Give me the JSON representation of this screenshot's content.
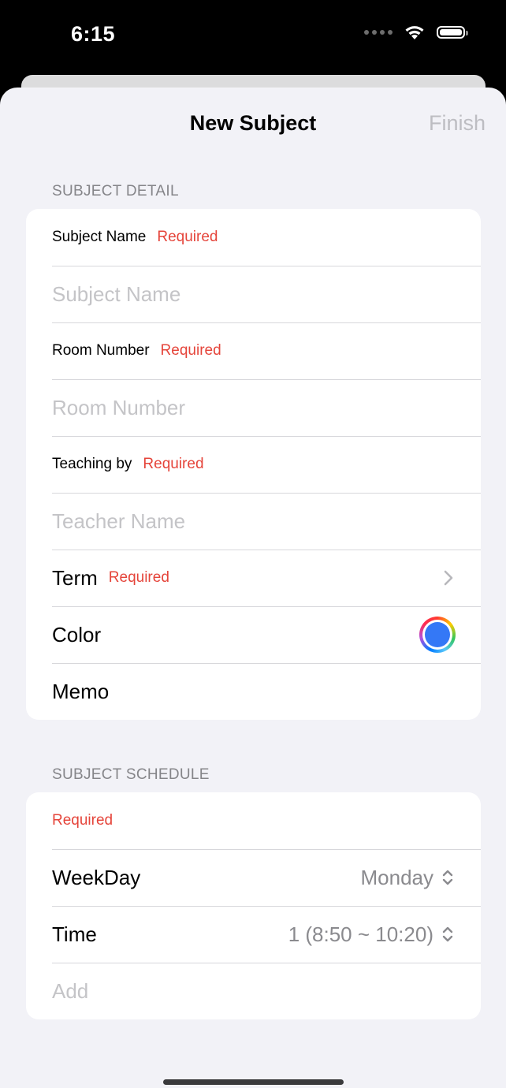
{
  "status_bar": {
    "time": "6:15"
  },
  "nav": {
    "title": "New Subject",
    "finish_label": "Finish"
  },
  "subject_detail": {
    "header": "SUBJECT DETAIL",
    "subject_name": {
      "label": "Subject Name",
      "required": "Required",
      "placeholder": "Subject Name"
    },
    "room_number": {
      "label": "Room Number",
      "required": "Required",
      "placeholder": "Room Number"
    },
    "teaching_by": {
      "label": "Teaching by",
      "required": "Required",
      "placeholder": "Teacher Name"
    },
    "term": {
      "label": "Term",
      "required": "Required"
    },
    "color": {
      "label": "Color",
      "value": "#3478f6"
    },
    "memo": {
      "label": "Memo"
    }
  },
  "subject_schedule": {
    "header": "SUBJECT SCHEDULE",
    "required": "Required",
    "weekday": {
      "label": "WeekDay",
      "value": "Monday"
    },
    "time": {
      "label": "Time",
      "value": "1 (8:50 ~ 10:20)"
    },
    "add_label": "Add"
  },
  "colors": {
    "accent_red": "#e5443a",
    "selected_color": "#3478f6"
  }
}
